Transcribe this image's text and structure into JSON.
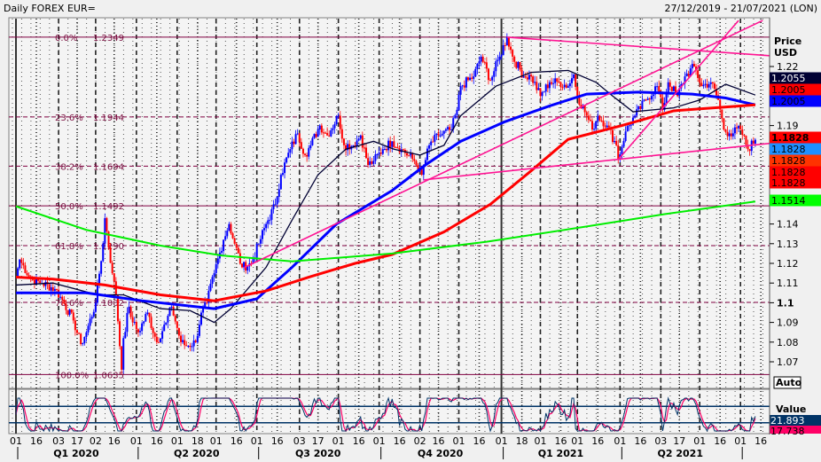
{
  "header": {
    "title": "Daily FOREX EUR=",
    "range": "27/12/2019 - 21/07/2021 (LON)"
  },
  "price_axis": {
    "title": "Price",
    "unit": "USD",
    "ticks": [
      {
        "label": "1.22",
        "value": 1.22,
        "bold": false
      },
      {
        "label": "1.19",
        "value": 1.19,
        "bold": false
      },
      {
        "label": "1.14",
        "value": 1.14,
        "bold": false
      },
      {
        "label": "1.13",
        "value": 1.13,
        "bold": false
      },
      {
        "label": "1.12",
        "value": 1.12,
        "bold": false
      },
      {
        "label": "1.11",
        "value": 1.11,
        "bold": false
      },
      {
        "label": "1.1",
        "value": 1.1,
        "bold": true
      },
      {
        "label": "1.09",
        "value": 1.09,
        "bold": false
      },
      {
        "label": "1.08",
        "value": 1.08,
        "bold": false
      },
      {
        "label": "1.07",
        "value": 1.07,
        "bold": false
      }
    ],
    "auto_button": "Auto",
    "badges": [
      {
        "label": "1.2055",
        "value": 1.2055,
        "bg": "#000033",
        "fg": "#ffffff",
        "bold": false
      },
      {
        "label": "1.2005",
        "value": 1.2005,
        "bg": "#ff0000",
        "fg": "#000000",
        "bold": false
      },
      {
        "label": "1.2005",
        "value": 1.2005,
        "bg": "#0000ff",
        "fg": "#000000",
        "bold": false
      },
      {
        "label": "1.1828",
        "value": 1.1828,
        "bg": "#ff0000",
        "fg": "#000000",
        "bold": true
      },
      {
        "label": "1.1828",
        "value": 1.1828,
        "bg": "#1e90ff",
        "fg": "#000000",
        "bold": false
      },
      {
        "label": "1.1828",
        "value": 1.1828,
        "bg": "#ff3300",
        "fg": "#000000",
        "bold": false
      },
      {
        "label": "1.1828",
        "value": 1.1828,
        "bg": "#ff0000",
        "fg": "#000000",
        "bold": false
      },
      {
        "label": "1.1828",
        "value": 1.1828,
        "bg": "#ff0000",
        "fg": "#000000",
        "bold": false
      },
      {
        "label": "1.1514",
        "value": 1.1514,
        "bg": "#00ff00",
        "fg": "#000000",
        "bold": false
      }
    ]
  },
  "oscillator": {
    "title": "Value",
    "value1": "21.893",
    "value2": "17.738",
    "color1": "#003366",
    "color2": "#ff0066",
    "levels": [
      75,
      25
    ]
  },
  "chart_data": {
    "type": "candlestick",
    "ylim": [
      1.0575,
      1.2545
    ],
    "colors": {
      "up": "#0000ff",
      "down": "#ff0000",
      "fib": "#800040",
      "trendline": "#ff1493"
    },
    "price": [
      [
        "2020-01-01",
        1.113
      ],
      [
        "2020-01-03",
        1.122
      ],
      [
        "2020-01-11",
        1.112
      ],
      [
        "2020-01-21",
        1.11
      ],
      [
        "2020-01-30",
        1.107
      ],
      [
        "2020-02-04",
        1.103
      ],
      [
        "2020-02-13",
        1.091
      ],
      [
        "2020-02-19",
        1.079
      ],
      [
        "2020-02-24",
        1.085
      ],
      [
        "2020-03-02",
        1.1
      ],
      [
        "2020-03-06",
        1.13
      ],
      [
        "2020-03-09",
        1.143
      ],
      [
        "2020-03-13",
        1.115
      ],
      [
        "2020-03-17",
        1.104
      ],
      [
        "2020-03-20",
        1.066
      ],
      [
        "2020-03-23",
        1.082
      ],
      [
        "2020-03-26",
        1.098
      ],
      [
        "2020-03-30",
        1.09
      ],
      [
        "2020-04-02",
        1.085
      ],
      [
        "2020-04-09",
        1.095
      ],
      [
        "2020-04-16",
        1.08
      ],
      [
        "2020-04-23",
        1.09
      ],
      [
        "2020-04-28",
        1.098
      ],
      [
        "2020-05-05",
        1.08
      ],
      [
        "2020-05-08",
        1.078
      ],
      [
        "2020-05-15",
        1.08
      ],
      [
        "2020-05-20",
        1.095
      ],
      [
        "2020-05-25",
        1.1
      ],
      [
        "2020-05-29",
        1.115
      ],
      [
        "2020-06-05",
        1.132
      ],
      [
        "2020-06-10",
        1.14
      ],
      [
        "2020-06-15",
        1.13
      ],
      [
        "2020-06-19",
        1.118
      ],
      [
        "2020-06-26",
        1.12
      ],
      [
        "2020-07-02",
        1.13
      ],
      [
        "2020-07-08",
        1.14
      ],
      [
        "2020-07-15",
        1.15
      ],
      [
        "2020-07-20",
        1.165
      ],
      [
        "2020-07-27",
        1.178
      ],
      [
        "2020-07-31",
        1.186
      ],
      [
        "2020-08-06",
        1.175
      ],
      [
        "2020-08-11",
        1.18
      ],
      [
        "2020-08-18",
        1.19
      ],
      [
        "2020-08-24",
        1.185
      ],
      [
        "2020-09-01",
        1.195
      ],
      [
        "2020-09-04",
        1.18
      ],
      [
        "2020-09-11",
        1.18
      ],
      [
        "2020-09-17",
        1.185
      ],
      [
        "2020-09-23",
        1.17
      ],
      [
        "2020-09-28",
        1.172
      ],
      [
        "2020-10-05",
        1.178
      ],
      [
        "2020-10-12",
        1.182
      ],
      [
        "2020-10-19",
        1.178
      ],
      [
        "2020-10-28",
        1.172
      ],
      [
        "2020-11-03",
        1.165
      ],
      [
        "2020-11-09",
        1.18
      ],
      [
        "2020-11-16",
        1.185
      ],
      [
        "2020-11-25",
        1.188
      ],
      [
        "2020-11-30",
        1.198
      ],
      [
        "2020-12-02",
        1.21
      ],
      [
        "2020-12-11",
        1.215
      ],
      [
        "2020-12-17",
        1.225
      ],
      [
        "2020-12-24",
        1.213
      ],
      [
        "2020-12-31",
        1.225
      ],
      [
        "2021-01-06",
        1.2349
      ],
      [
        "2021-01-11",
        1.225
      ],
      [
        "2021-01-19",
        1.215
      ],
      [
        "2021-01-25",
        1.215
      ],
      [
        "2021-02-01",
        1.205
      ],
      [
        "2021-02-08",
        1.212
      ],
      [
        "2021-02-15",
        1.212
      ],
      [
        "2021-02-22",
        1.21
      ],
      [
        "2021-02-25",
        1.216
      ],
      [
        "2021-03-01",
        1.205
      ],
      [
        "2021-03-08",
        1.195
      ],
      [
        "2021-03-11",
        1.188
      ],
      [
        "2021-03-16",
        1.195
      ],
      [
        "2021-03-23",
        1.19
      ],
      [
        "2021-03-30",
        1.18
      ],
      [
        "2021-03-31",
        1.173
      ],
      [
        "2021-04-06",
        1.187
      ],
      [
        "2021-04-13",
        1.195
      ],
      [
        "2021-04-21",
        1.203
      ],
      [
        "2021-04-29",
        1.21
      ],
      [
        "2021-05-04",
        1.198
      ],
      [
        "2021-05-07",
        1.212
      ],
      [
        "2021-05-14",
        1.205
      ],
      [
        "2021-05-20",
        1.215
      ],
      [
        "2021-05-27",
        1.22
      ],
      [
        "2021-06-02",
        1.21
      ],
      [
        "2021-06-09",
        1.212
      ],
      [
        "2021-06-15",
        1.203
      ],
      [
        "2021-06-18",
        1.188
      ],
      [
        "2021-06-23",
        1.186
      ],
      [
        "2021-07-01",
        1.188
      ],
      [
        "2021-07-07",
        1.178
      ],
      [
        "2021-07-13",
        1.1828
      ]
    ],
    "moving_averages": [
      {
        "color": "#000033",
        "width": 1.3,
        "points": [
          [
            "2020-01-01",
            1.109
          ],
          [
            "2020-01-29",
            1.11
          ],
          [
            "2020-03-03",
            1.104
          ],
          [
            "2020-03-22",
            1.104
          ],
          [
            "2020-04-18",
            1.097
          ],
          [
            "2020-05-12",
            1.096
          ],
          [
            "2020-05-29",
            1.09
          ],
          [
            "2020-06-11",
            1.097
          ],
          [
            "2020-07-08",
            1.118
          ],
          [
            "2020-07-28",
            1.142
          ],
          [
            "2020-08-17",
            1.165
          ],
          [
            "2020-09-06",
            1.178
          ],
          [
            "2020-09-26",
            1.182
          ],
          [
            "2020-10-13",
            1.178
          ],
          [
            "2020-11-02",
            1.175
          ],
          [
            "2020-11-19",
            1.18
          ],
          [
            "2020-12-02",
            1.195
          ],
          [
            "2020-12-29",
            1.21
          ],
          [
            "2021-01-25",
            1.217
          ],
          [
            "2021-02-21",
            1.218
          ],
          [
            "2021-03-13",
            1.212
          ],
          [
            "2021-03-26",
            1.205
          ],
          [
            "2021-04-11",
            1.197
          ],
          [
            "2021-05-12",
            1.199
          ],
          [
            "2021-06-01",
            1.203
          ],
          [
            "2021-06-19",
            1.211
          ],
          [
            "2021-07-13",
            1.2055
          ]
        ]
      },
      {
        "color": "#0000ff",
        "width": 3,
        "points": [
          [
            "2020-01-01",
            1.105
          ],
          [
            "2020-02-24",
            1.105
          ],
          [
            "2020-04-05",
            1.101
          ],
          [
            "2020-05-29",
            1.097
          ],
          [
            "2020-07-01",
            1.102
          ],
          [
            "2020-07-28",
            1.118
          ],
          [
            "2020-08-30",
            1.14
          ],
          [
            "2020-10-10",
            1.157
          ],
          [
            "2020-11-05",
            1.17
          ],
          [
            "2020-12-02",
            1.182
          ],
          [
            "2021-01-05",
            1.192
          ],
          [
            "2021-02-07",
            1.2
          ],
          [
            "2021-03-06",
            1.206
          ],
          [
            "2021-04-15",
            1.207
          ],
          [
            "2021-05-26",
            1.206
          ],
          [
            "2021-06-21",
            1.204
          ],
          [
            "2021-07-13",
            1.2005
          ]
        ]
      },
      {
        "color": "#ff0000",
        "width": 3,
        "points": [
          [
            "2020-01-01",
            1.113
          ],
          [
            "2020-01-29",
            1.112
          ],
          [
            "2020-03-09",
            1.109
          ],
          [
            "2020-04-18",
            1.104
          ],
          [
            "2020-05-29",
            1.101
          ],
          [
            "2020-07-08",
            1.106
          ],
          [
            "2020-08-10",
            1.113
          ],
          [
            "2020-09-13",
            1.12
          ],
          [
            "2020-10-10",
            1.1245
          ],
          [
            "2020-11-19",
            1.136
          ],
          [
            "2020-12-24",
            1.15
          ],
          [
            "2021-01-25",
            1.167
          ],
          [
            "2021-02-21",
            1.183
          ],
          [
            "2021-04-02",
            1.19
          ],
          [
            "2021-05-12",
            1.1975
          ],
          [
            "2021-07-13",
            1.2005
          ]
        ]
      },
      {
        "color": "#00ee00",
        "width": 2,
        "points": [
          [
            "2020-01-01",
            1.149
          ],
          [
            "2020-02-24",
            1.137
          ],
          [
            "2020-04-18",
            1.129
          ],
          [
            "2020-06-04",
            1.124
          ],
          [
            "2020-07-28",
            1.121
          ],
          [
            "2020-10-10",
            1.125
          ],
          [
            "2020-12-22",
            1.131
          ],
          [
            "2021-02-27",
            1.138
          ],
          [
            "2021-05-05",
            1.145
          ],
          [
            "2021-07-13",
            1.1514
          ]
        ]
      }
    ],
    "trendlines": [
      [
        [
          "2021-01-06",
          1.2349
        ],
        [
          "2021-07-25",
          1.2254
        ]
      ],
      [
        [
          "2020-06-22",
          1.1178
        ],
        [
          "2021-07-18",
          1.2434
        ]
      ],
      [
        [
          "2020-11-04",
          1.1624
        ],
        [
          "2021-07-23",
          1.181
        ]
      ],
      [
        [
          "2021-03-31",
          1.1727
        ],
        [
          "2021-06-30",
          1.2434
        ]
      ]
    ],
    "fibonacci": [
      {
        "pct": "0.0%",
        "price": "1.2349",
        "value": 1.2349,
        "dashed": false
      },
      {
        "pct": "23.6%",
        "price": "1.1944",
        "value": 1.1944,
        "dashed": true
      },
      {
        "pct": "38.2%",
        "price": "1.1694",
        "value": 1.1694,
        "dashed": true
      },
      {
        "pct": "50.0%",
        "price": "1.1492",
        "value": 1.1492,
        "dashed": false
      },
      {
        "pct": "61.8%",
        "price": "1.1290",
        "value": 1.129,
        "dashed": true
      },
      {
        "pct": "78.6%",
        "price": "1.1002",
        "value": 1.1002,
        "dashed": true
      },
      {
        "pct": "100.0%",
        "price": "1.0635",
        "value": 1.0635,
        "dashed": false
      }
    ],
    "x_ticks": [
      {
        "label": "01",
        "date": "2020-01-01"
      },
      {
        "label": "16",
        "date": "2020-01-16"
      },
      {
        "label": "03",
        "date": "2020-02-03"
      },
      {
        "label": "17",
        "date": "2020-02-17"
      },
      {
        "label": "02",
        "date": "2020-03-02"
      },
      {
        "label": "16",
        "date": "2020-03-16"
      },
      {
        "label": "01",
        "date": "2020-04-01"
      },
      {
        "label": "16",
        "date": "2020-04-16"
      },
      {
        "label": "01",
        "date": "2020-05-01"
      },
      {
        "label": "18",
        "date": "2020-05-18"
      },
      {
        "label": "01",
        "date": "2020-06-01"
      },
      {
        "label": "16",
        "date": "2020-06-16"
      },
      {
        "label": "01",
        "date": "2020-07-01"
      },
      {
        "label": "16",
        "date": "2020-07-16"
      },
      {
        "label": "03",
        "date": "2020-08-03"
      },
      {
        "label": "17",
        "date": "2020-08-17"
      },
      {
        "label": "01",
        "date": "2020-09-01"
      },
      {
        "label": "16",
        "date": "2020-09-16"
      },
      {
        "label": "01",
        "date": "2020-10-01"
      },
      {
        "label": "16",
        "date": "2020-10-16"
      },
      {
        "label": "02",
        "date": "2020-11-02"
      },
      {
        "label": "16",
        "date": "2020-11-16"
      },
      {
        "label": "01",
        "date": "2020-12-01"
      },
      {
        "label": "16",
        "date": "2020-12-16"
      },
      {
        "label": "01",
        "date": "2021-01-01"
      },
      {
        "label": "18",
        "date": "2021-01-18"
      },
      {
        "label": "01",
        "date": "2021-02-01"
      },
      {
        "label": "16",
        "date": "2021-02-16"
      },
      {
        "label": "01",
        "date": "2021-03-01"
      },
      {
        "label": "16",
        "date": "2021-03-16"
      },
      {
        "label": "01",
        "date": "2021-04-01"
      },
      {
        "label": "16",
        "date": "2021-04-16"
      },
      {
        "label": "03",
        "date": "2021-05-03"
      },
      {
        "label": "17",
        "date": "2021-05-17"
      },
      {
        "label": "01",
        "date": "2021-06-01"
      },
      {
        "label": "16",
        "date": "2021-06-16"
      },
      {
        "label": "01",
        "date": "2021-07-01"
      },
      {
        "label": "16",
        "date": "2021-07-16"
      }
    ],
    "quarters": [
      {
        "label": "Q1 2020",
        "start": "2020-01-01",
        "end": "2020-04-01"
      },
      {
        "label": "Q2 2020",
        "start": "2020-04-01",
        "end": "2020-07-01"
      },
      {
        "label": "Q3 2020",
        "start": "2020-07-01",
        "end": "2020-10-01"
      },
      {
        "label": "Q4 2020",
        "start": "2020-10-01",
        "end": "2021-01-01"
      },
      {
        "label": "Q1 2021",
        "start": "2021-01-01",
        "end": "2021-04-01"
      },
      {
        "label": "Q2 2021",
        "start": "2021-04-01",
        "end": "2021-07-01"
      }
    ]
  }
}
